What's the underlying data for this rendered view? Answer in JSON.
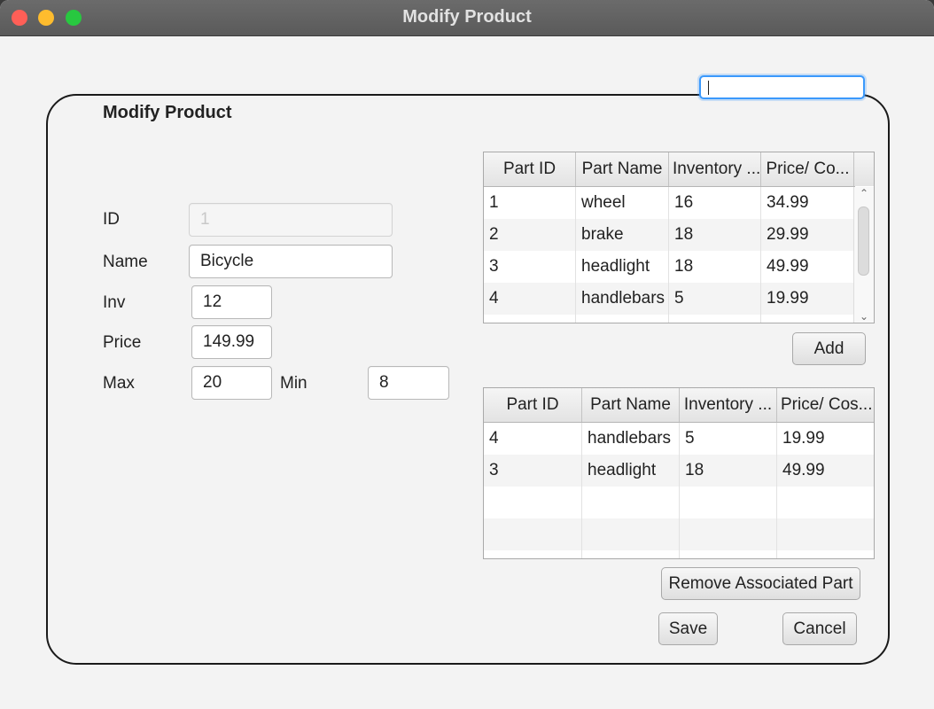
{
  "window": {
    "title": "Modify Product"
  },
  "form": {
    "heading": "Modify Product",
    "id_label": "ID",
    "id_value": "1",
    "name_label": "Name",
    "name_value": "Bicycle",
    "inv_label": "Inv",
    "inv_value": "12",
    "price_label": "Price",
    "price_value": "149.99",
    "max_label": "Max",
    "max_value": "20",
    "min_label": "Min",
    "min_value": "8"
  },
  "search": {
    "value": ""
  },
  "parts_table": {
    "headers": [
      "Part ID",
      "Part Name",
      "Inventory ...",
      "Price/ Co..."
    ],
    "rows": [
      [
        "1",
        "wheel",
        "16",
        "34.99"
      ],
      [
        "2",
        "brake",
        "18",
        "29.99"
      ],
      [
        "3",
        "headlight",
        "18",
        "49.99"
      ],
      [
        "4",
        "handlebars",
        "5",
        "19.99"
      ]
    ]
  },
  "associated_table": {
    "headers": [
      "Part ID",
      "Part Name",
      "Inventory ...",
      "Price/ Cos..."
    ],
    "rows": [
      [
        "4",
        "handlebars",
        "5",
        "19.99"
      ],
      [
        "3",
        "headlight",
        "18",
        "49.99"
      ]
    ]
  },
  "buttons": {
    "add": "Add",
    "remove": "Remove Associated Part",
    "save": "Save",
    "cancel": "Cancel"
  }
}
